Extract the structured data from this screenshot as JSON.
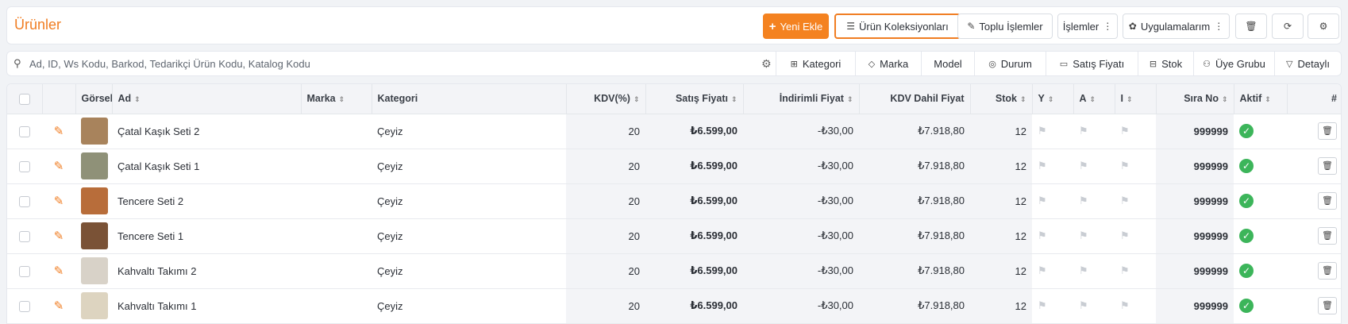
{
  "header": {
    "title": "Ürünler",
    "buttons": {
      "new": "Yeni Ekle",
      "collections": "Ürün Koleksiyonları",
      "bulk": "Toplu İşlemler",
      "actions": "İşlemler",
      "apps": "Uygulamalarım"
    }
  },
  "search": {
    "placeholder": "Ad, ID, Ws Kodu, Barkod, Tedarikçi Ürün Kodu, Katalog Kodu",
    "filters": [
      "Kategori",
      "Marka",
      "Model",
      "Durum",
      "Satış Fiyatı",
      "Stok",
      "Üye Grubu",
      "Detaylı"
    ]
  },
  "table": {
    "columns": {
      "image": "Görsel",
      "name": "Ad",
      "brand": "Marka",
      "category": "Kategori",
      "vat": "KDV(%)",
      "price": "Satış Fiyatı",
      "discount": "İndirimli Fiyat",
      "vat_price": "KDV Dahil Fiyat",
      "stock": "Stok",
      "y": "Y",
      "a": "A",
      "i": "I",
      "order": "Sıra No",
      "active": "Aktif",
      "hash": "#"
    },
    "rows": [
      {
        "name": "Çatal Kaşık Seti 2",
        "brand": "",
        "category": "Çeyiz",
        "vat": "20",
        "price": "₺6.599,00",
        "discount": "-₺30,00",
        "vat_price": "₺7.918,80",
        "stock": "12",
        "order": "999999",
        "active": true,
        "thumb_color": "#a8835c"
      },
      {
        "name": "Çatal Kaşık Seti 1",
        "brand": "",
        "category": "Çeyiz",
        "vat": "20",
        "price": "₺6.599,00",
        "discount": "-₺30,00",
        "vat_price": "₺7.918,80",
        "stock": "12",
        "order": "999999",
        "active": true,
        "thumb_color": "#8f9178"
      },
      {
        "name": "Tencere Seti 2",
        "brand": "",
        "category": "Çeyiz",
        "vat": "20",
        "price": "₺6.599,00",
        "discount": "-₺30,00",
        "vat_price": "₺7.918,80",
        "stock": "12",
        "order": "999999",
        "active": true,
        "thumb_color": "#b86d3a"
      },
      {
        "name": "Tencere Seti 1",
        "brand": "",
        "category": "Çeyiz",
        "vat": "20",
        "price": "₺6.599,00",
        "discount": "-₺30,00",
        "vat_price": "₺7.918,80",
        "stock": "12",
        "order": "999999",
        "active": true,
        "thumb_color": "#7a5236"
      },
      {
        "name": "Kahvaltı Takımı 2",
        "brand": "",
        "category": "Çeyiz",
        "vat": "20",
        "price": "₺6.599,00",
        "discount": "-₺30,00",
        "vat_price": "₺7.918,80",
        "stock": "12",
        "order": "999999",
        "active": true,
        "thumb_color": "#d8d2c8"
      },
      {
        "name": "Kahvaltı Takımı 1",
        "brand": "",
        "category": "Çeyiz",
        "vat": "20",
        "price": "₺6.599,00",
        "discount": "-₺30,00",
        "vat_price": "₺7.918,80",
        "stock": "12",
        "order": "999999",
        "active": true,
        "thumb_color": "#ddd4c0"
      }
    ]
  },
  "colors": {
    "accent": "#f48220",
    "active": "#3cb55a"
  }
}
